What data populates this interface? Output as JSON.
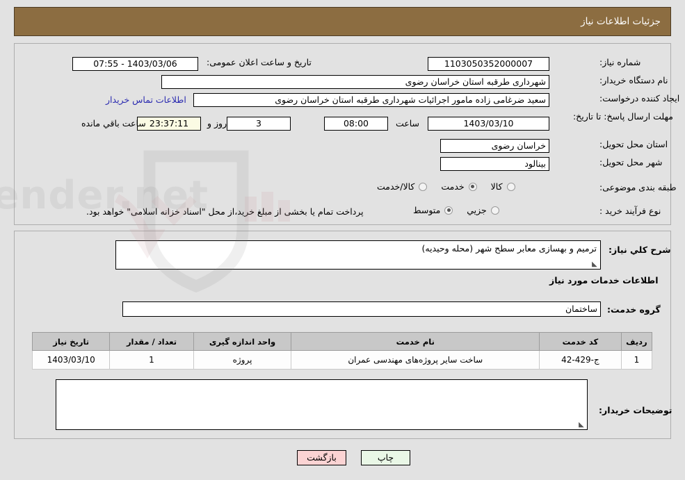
{
  "header": {
    "title": "جزئیات اطلاعات نیاز"
  },
  "watermark": {
    "text": "AnaTender.net"
  },
  "top_form": {
    "need_number": {
      "label": "شماره نیاز:",
      "value": "1103050352000007"
    },
    "public_announce": {
      "label": "تاریخ و ساعت اعلان عمومی:",
      "value": "1403/03/06 - 07:55"
    },
    "buyer_org": {
      "label": "نام دستگاه خریدار:",
      "value": "شهرداری طرقبه استان خراسان رضوی"
    },
    "creator": {
      "label": "ایجاد کننده درخواست:",
      "value": "سعید ضرغامی زاده مامور اجرائیات شهرداری طرقبه استان خراسان رضوی",
      "contact_link": "اطلاعات تماس خریدار"
    },
    "deadline": {
      "label": "مهلت ارسال پاسخ: تا تاریخ:",
      "date": "1403/03/10",
      "hour_label": "ساعت",
      "hour": "08:00",
      "days": "3",
      "days_label": "روز و",
      "countdown": "23:37:11",
      "remaining_label": "ساعت باقي مانده"
    },
    "province": {
      "label": "استان محل تحویل:",
      "value": "خراسان رضوی"
    },
    "city": {
      "label": "شهر محل تحویل:",
      "value": "بینالود"
    },
    "subject_class": {
      "label": "طبقه بندی موضوعی:",
      "options": [
        {
          "text": "کالا",
          "selected": false
        },
        {
          "text": "خدمت",
          "selected": true
        },
        {
          "text": "کالا/خدمت",
          "selected": false
        }
      ]
    },
    "purchase_process": {
      "label": "نوع فرآیند خرید :",
      "options": [
        {
          "text": "جزیي",
          "selected": false
        },
        {
          "text": "متوسط",
          "selected": true
        }
      ],
      "note": "پرداخت تمام یا بخشی از مبلغ خرید،از محل \"اسناد خزانه اسلامی\" خواهد بود."
    }
  },
  "mid_form": {
    "general_desc": {
      "label": "شرح کلي نیاز:",
      "value": "ترمیم و بهسازی معابر سطح شهر (محله وحیدیه)"
    },
    "services_section_title": "اطلاعات خدمات مورد نیاز",
    "service_group": {
      "label": "گروه خدمت:",
      "value": "ساختمان"
    },
    "buyer_notes": {
      "label": "توضیحات خریدار:",
      "value": ""
    }
  },
  "table": {
    "columns": [
      "ردیف",
      "کد خدمت",
      "نام خدمت",
      "واحد اندازه گیری",
      "تعداد / مقدار",
      "تاریخ نیاز"
    ],
    "rows": [
      {
        "row": "1",
        "code": "ج-429-42",
        "name": "ساخت سایر پروژه‌های مهندسی عمران",
        "unit": "پروژه",
        "qty": "1",
        "date": "1403/03/10"
      }
    ]
  },
  "footer": {
    "print_label": "چاپ",
    "back_label": "بازگشت"
  },
  "colors": {
    "header_bg": "#8c6d41",
    "panel_bg": "#e2e2e2",
    "link": "#2a2ab0",
    "table_header": "#c8c8c8",
    "btn_print": "#e9f7e6",
    "btn_back": "#fbd3d3",
    "countdown_bg": "#fbfbe4"
  }
}
